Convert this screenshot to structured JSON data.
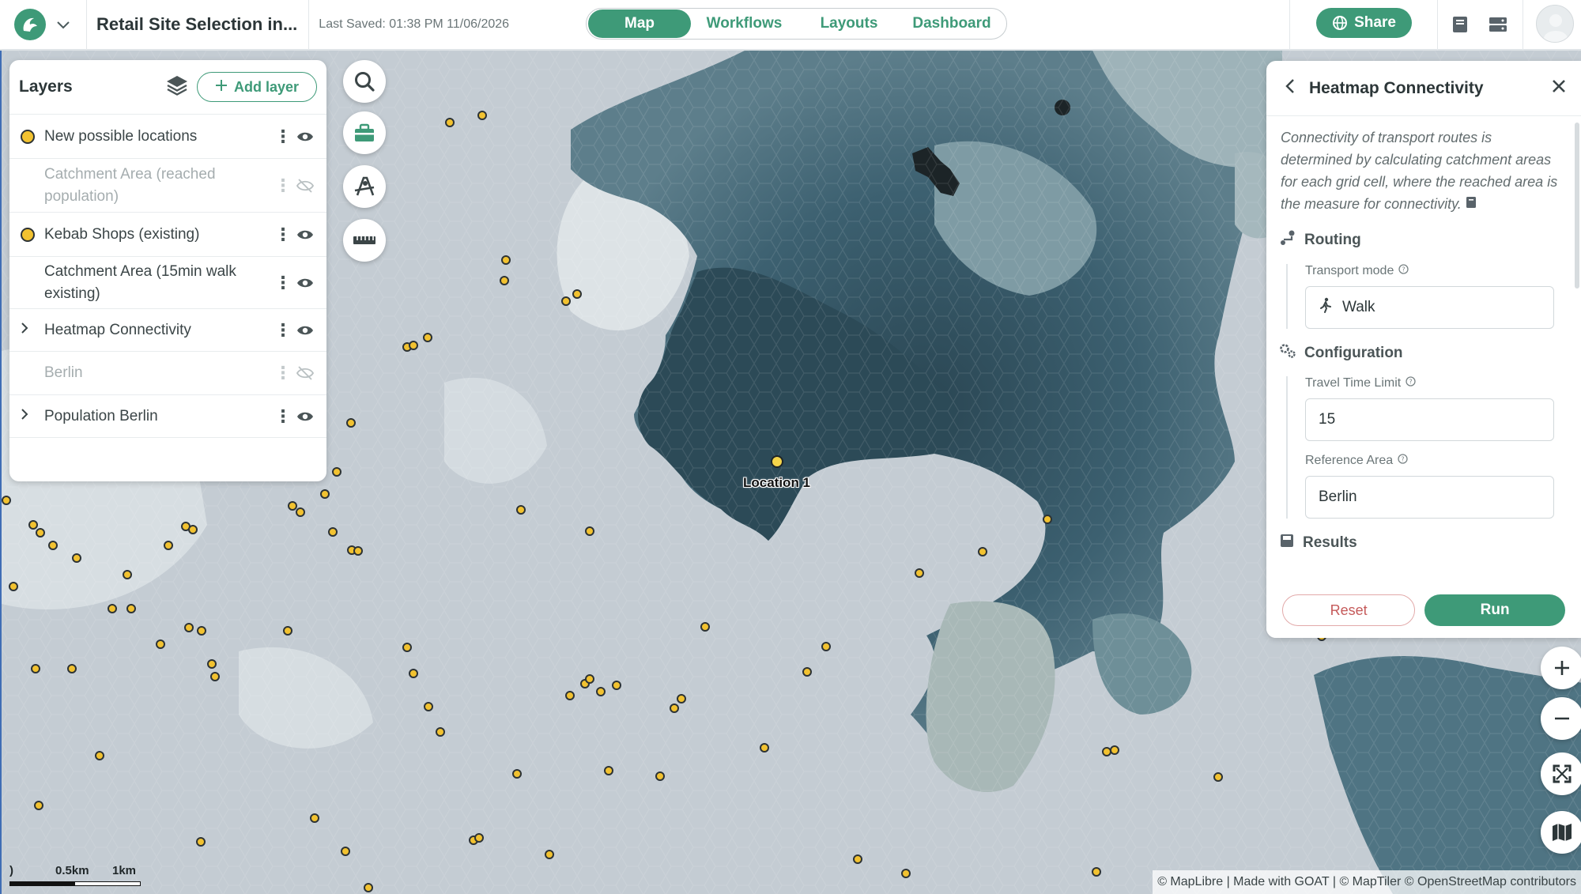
{
  "header": {
    "project_title": "Retail Site Selection in...",
    "last_saved": "Last Saved: 01:38 PM 11/06/2026",
    "tabs": [
      {
        "label": "Map",
        "active": true
      },
      {
        "label": "Workflows",
        "active": false
      },
      {
        "label": "Layouts",
        "active": false
      },
      {
        "label": "Dashboard",
        "active": false
      }
    ],
    "share_label": "Share",
    "icons": [
      "logo-icon",
      "chevron-down-icon",
      "globe-icon",
      "book-icon",
      "storage-icon",
      "user-avatar"
    ]
  },
  "layers_panel": {
    "title": "Layers",
    "add_layer_label": "Add layer",
    "items": [
      {
        "name": "New possible locations",
        "legend": "point",
        "visible": true,
        "expandable": false
      },
      {
        "name": "Catchment Area (reached population)",
        "legend": "none",
        "visible": false,
        "expandable": false
      },
      {
        "name": "Kebab Shops (existing)",
        "legend": "point",
        "visible": true,
        "expandable": false
      },
      {
        "name": "Catchment Area (15min walk existing)",
        "legend": "none",
        "visible": true,
        "expandable": false
      },
      {
        "name": "Heatmap Connectivity",
        "legend": "none",
        "visible": true,
        "expandable": true
      },
      {
        "name": "Berlin",
        "legend": "none",
        "visible": false,
        "expandable": false
      },
      {
        "name": "Population Berlin",
        "legend": "none",
        "visible": true,
        "expandable": true
      }
    ]
  },
  "map_tools": [
    "search-icon",
    "toolbox-icon",
    "draw-icon",
    "ruler-icon"
  ],
  "map": {
    "marker_label": "Location 1",
    "attribution": "© MapLibre | Made with GOAT | © MapTiler © OpenStreetMap contributors",
    "scale": {
      "start": ")",
      "mid": "0.5km",
      "end": "1km"
    },
    "point_color": "#f2c230"
  },
  "tool_panel": {
    "title": "Heatmap Connectivity",
    "description": "Connectivity of transport routes is determined by calculating catchment areas for each grid cell, where the reached area is the measure for connectivity.",
    "sections": {
      "routing": {
        "title": "Routing",
        "transport_mode_label": "Transport mode",
        "transport_mode_value": "Walk"
      },
      "configuration": {
        "title": "Configuration",
        "travel_time_label": "Travel Time Limit",
        "travel_time_value": "15",
        "reference_area_label": "Reference Area",
        "reference_area_value": "Berlin"
      },
      "results": {
        "title": "Results"
      }
    },
    "reset_label": "Reset",
    "run_label": "Run"
  },
  "zoom_controls": [
    "zoom-in-icon",
    "zoom-out-icon",
    "fullscreen-icon",
    "basemap-icon"
  ],
  "colors": {
    "accent": "#3e9a78",
    "reset": "#c55a5a",
    "heat_dark": "#2b4a57",
    "heat_light": "#d6dde2"
  }
}
